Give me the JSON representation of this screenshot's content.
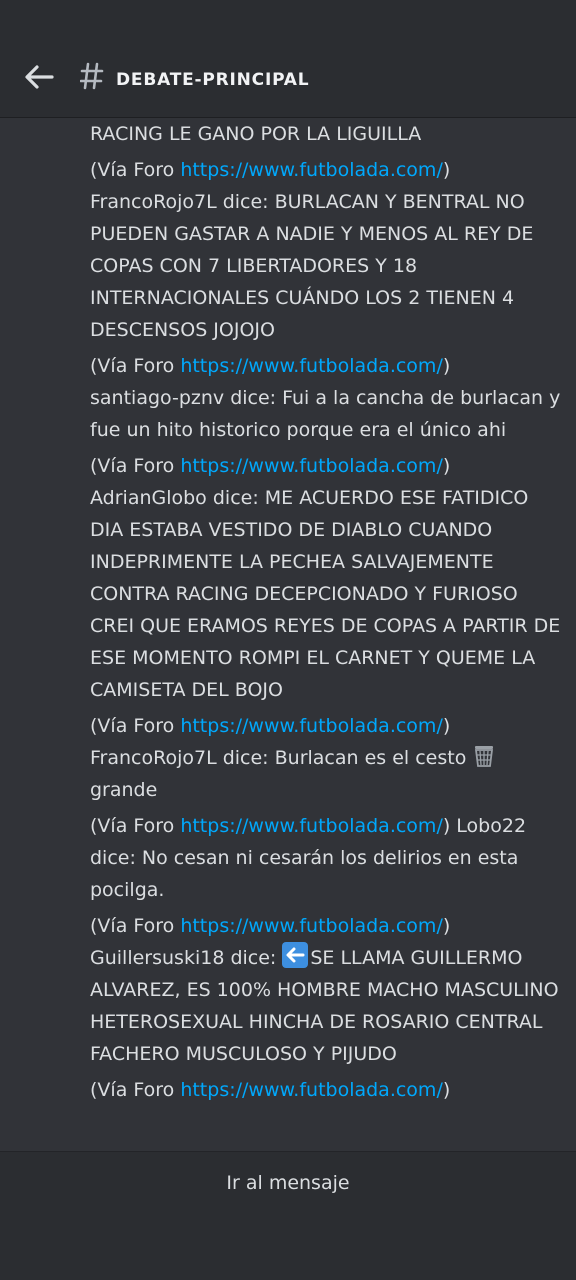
{
  "header": {
    "title": "DEBATE-PRINCIPAL"
  },
  "messages": [
    {
      "prefix": "RACING LE GANO POR LA LIGUILLA"
    },
    {
      "via": "(Vía Foro ",
      "link": "https://www.futbolada.com/",
      "close": ")",
      "text": "\nFrancoRojo7L dice: BURLACAN Y BENTRAL NO PUEDEN GASTAR A NADIE Y MENOS AL REY DE COPAS CON 7 LIBERTADORES Y 18 INTERNACIONALES CUÁNDO LOS 2 TIENEN 4 DESCENSOS JOJOJO"
    },
    {
      "via": "(Vía Foro ",
      "link": "https://www.futbolada.com/",
      "close": ")",
      "text": "\nsantiago-pznv dice: Fui a la cancha de burlacan y fue un hito historico porque era el único ahi"
    },
    {
      "via": "(Vía Foro ",
      "link": "https://www.futbolada.com/",
      "close": ")",
      "text": "\nAdrianGlobo dice: ME ACUERDO ESE FATIDICO DIA ESTABA VESTIDO DE DIABLO CUANDO INDEPRIMENTE LA PECHEA SALVAJEMENTE CONTRA RACING DECEPCIONADO Y FURIOSO CREI QUE ERAMOS REYES DE COPAS A PARTIR DE ESE MOMENTO ROMPI EL CARNET Y QUEME LA CAMISETA DEL BOJO"
    },
    {
      "via": "(Vía Foro ",
      "link": "https://www.futbolada.com/",
      "close": ")",
      "text": "\nFrancoRojo7L dice: Burlacan es el cesto ",
      "emoji": "basket-icon",
      "after": "\ngrande"
    },
    {
      "via": "(Vía Foro ",
      "link": "https://www.futbolada.com/",
      "close": ")",
      "text": " Lobo22 dice: No cesan ni cesarán los delirios en esta pocilga."
    },
    {
      "via": "(Vía Foro ",
      "link": "https://www.futbolada.com/",
      "close": ")",
      "text": "\nGuillersuski18 dice: ",
      "emoji": "left-arrow-icon",
      "after": "SE LLAMA GUILLERMO ALVAREZ, ES 100% HOMBRE MACHO MASCULINO HETEROSEXUAL HINCHA DE ROSARIO CENTRAL FACHERO MUSCULOSO Y PIJUDO"
    },
    {
      "via": "(Vía Foro ",
      "link": "https://www.futbolada.com/",
      "close": ")",
      "text": ""
    }
  ],
  "footer": {
    "jump_label": "Ir al mensaje"
  },
  "colors": {
    "background": "#313338",
    "header": "#2b2d31",
    "link": "#00a8fc",
    "text": "#dbdee1"
  }
}
